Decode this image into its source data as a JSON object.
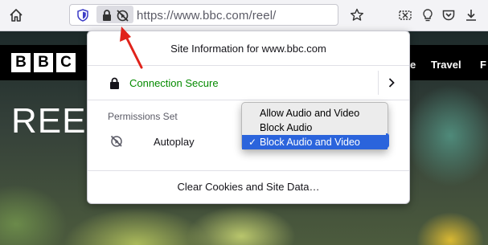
{
  "browser": {
    "url": "https://www.bbc.com/reel/"
  },
  "page": {
    "logo_letters": [
      "B",
      "B",
      "C"
    ],
    "nav_items": [
      "e",
      "Travel",
      "F"
    ],
    "title": "REEL"
  },
  "panel": {
    "title": "Site Information for www.bbc.com",
    "connection_label": "Connection Secure",
    "permissions_label": "Permissions Set",
    "autoplay_label": "Autoplay",
    "clear_label": "Clear Cookies and Site Data…"
  },
  "autoplay_dropdown": {
    "options": [
      "Allow Audio and Video",
      "Block Audio",
      "Block Audio and Video"
    ],
    "selected": "Block Audio and Video",
    "check_glyph": "✓"
  },
  "colors": {
    "secure_green": "#058b00",
    "selection_blue": "#2b64dc",
    "annotation_red": "#e0221a"
  },
  "icons": {
    "toolbar_left": [
      "home-icon"
    ],
    "urlbar": [
      "tracking-protection-shield-icon",
      "lock-icon",
      "autoplay-blocked-icon"
    ],
    "toolbar_right": [
      "bookmark-star-icon",
      "screenshot-icon",
      "lightbulb-icon",
      "pocket-icon",
      "download-icon"
    ]
  }
}
